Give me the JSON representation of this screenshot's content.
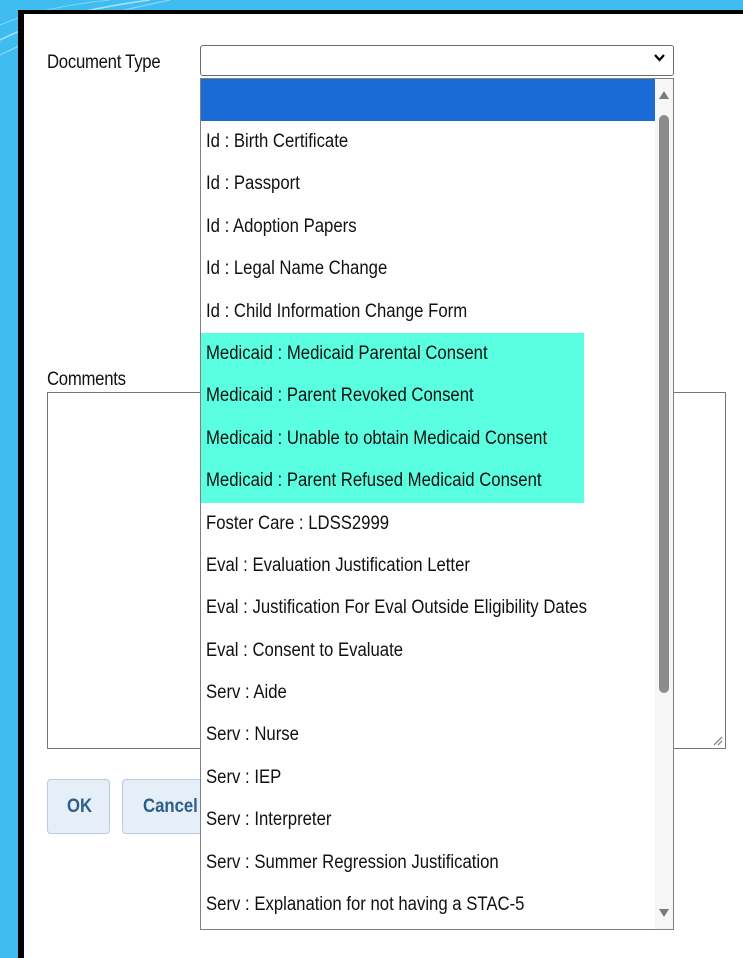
{
  "form": {
    "document_type_label": "Document Type",
    "document_type_value": "",
    "comments_label": "Comments",
    "comments_value": ""
  },
  "buttons": {
    "ok_label": "OK",
    "cancel_label": "Cancel"
  },
  "dropdown": {
    "options": [
      "",
      "Id : Birth Certificate",
      "Id : Passport",
      "Id : Adoption Papers",
      "Id : Legal Name Change",
      "Id : Child Information Change Form",
      "Medicaid : Medicaid Parental Consent",
      "Medicaid : Parent Revoked Consent",
      "Medicaid : Unable to obtain Medicaid Consent",
      "Medicaid : Parent Refused Medicaid Consent",
      "Foster Care : LDSS2999",
      "Eval : Evaluation Justification Letter",
      "Eval : Justification For Eval Outside Eligibility Dates",
      "Eval : Consent to Evaluate",
      "Serv : Aide",
      "Serv : Nurse",
      "Serv : IEP",
      "Serv : Interpreter",
      "Serv : Summer Regression Justification",
      "Serv : Explanation for not having a STAC-5"
    ],
    "selected_index": 0,
    "highlighted_indices": [
      6,
      7,
      8,
      9
    ]
  },
  "colors": {
    "selected_option": "#1c6ad6",
    "highlight": "#59ffe0",
    "slide_background": "#3fbdf0",
    "button_text": "#2c5f8a"
  },
  "icons": {
    "select": "chevron-down-icon",
    "scroll_up": "scroll-up-arrow-icon",
    "scroll_down": "scroll-down-arrow-icon",
    "resize": "resize-grip-icon"
  }
}
